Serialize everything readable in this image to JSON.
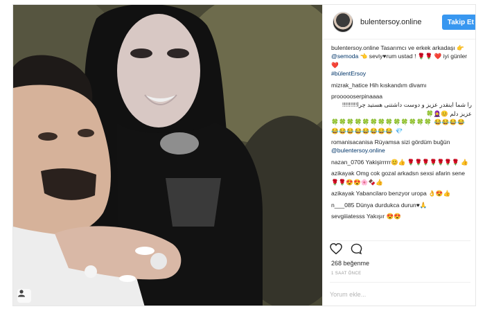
{
  "post": {
    "username": "bulentersoy.online",
    "follow_label": "Takip Et",
    "caption_user": "bulentersoy.online",
    "caption_text": "Tasarımcı ve erkek arkadaşı 👉 ",
    "caption_mention": "@semoda",
    "caption_text2": " 👈 seviy♥rum ustad !",
    "caption_text3": "🌹🌹 ❤️ iyi günler ❤️",
    "caption_hashtag": "#bülentErsoy",
    "likes": "268 beğenme",
    "time": "1 SAAT ÖNCE",
    "comment_placeholder": "Yorum ekle..."
  },
  "comments": [
    {
      "user": "mizrak_hatice",
      "text": "Hih kıskandım divamı"
    },
    {
      "user": "proooooserpinaaaa",
      "text": "را شما اینقدر عزیز و دوست داشتنی هستید چرا!!!!!!!!! عزیز دلم 😊🧕🍀",
      "emoji": "🍀🍀🍀🍀🍀🍀🍀🍀🍀🍀🍀🍀🍀 😂😂😂😂😂😂😂😂😂😂😂😂 💎"
    },
    {
      "user": "romanisacanisa",
      "text": "Rüyamsa sizi gördüm buğün",
      "mention": "@bulentersoy.online"
    },
    {
      "user": "nazan_0706",
      "text": "Yakişirrrrr😊👍 🌹🌹🌹🌹🌹🌹🌹 👍"
    },
    {
      "user": "azikayak",
      "text": "Omg cok gozal arkadsn sexsi afarin sene 🌹🌹😍😍🌸🍫👍"
    },
    {
      "user": "azikayak",
      "text": "Yabancilaro benzyor uropa 👌😍👍"
    },
    {
      "user": "n___085",
      "text": "Dünya durdukca durun♥🙏"
    },
    {
      "user": "sevgiiiatesss",
      "text": "Yakışır 😍😍"
    }
  ],
  "icons": {
    "like": "heart-icon",
    "comment": "comment-icon",
    "tag": "user-tag-icon"
  }
}
